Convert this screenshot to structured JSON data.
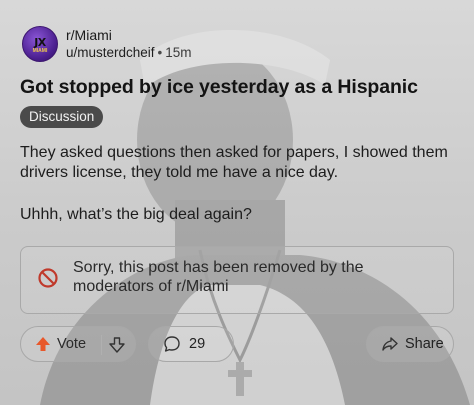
{
  "post": {
    "subreddit": "r/Miami",
    "author": "u/musterdcheif",
    "separator": "•",
    "age": "15m",
    "title": "Got stopped by ice yesterday as a Hispanic",
    "flair": "Discussion",
    "body": [
      "They asked questions then asked for papers, I showed them drivers license, they told me have a nice day.",
      "Uhhh, what’s the big deal again?"
    ]
  },
  "avatar": {
    "logo_text": "JX",
    "logo_subtext": "MIAMI"
  },
  "removal_notice": {
    "icon": "ban-icon",
    "text": "Sorry, this post has been removed by the moderators of r/Miami",
    "icon_color": "#c0392b"
  },
  "actions": {
    "vote_label": "Vote",
    "upvote_icon": "upvote-arrow-icon",
    "upvote_color": "#e8582b",
    "downvote_icon": "downvote-arrow-icon",
    "comment_icon": "comment-bubble-icon",
    "comment_count": "29",
    "share_icon": "share-arrow-icon",
    "share_label": "Share"
  },
  "colors": {
    "background": "#cfcfcf",
    "flair_bg": "#4a4a4a",
    "text": "#1a1a1b"
  }
}
